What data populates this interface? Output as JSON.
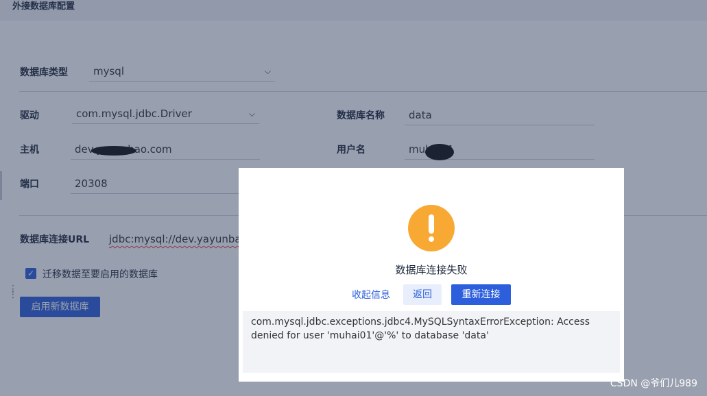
{
  "header": {
    "title": "外接数据库配置"
  },
  "form": {
    "db_type": {
      "label": "数据库类型",
      "value": "mysql"
    },
    "driver": {
      "label": "驱动",
      "value": "com.mysql.jdbc.Driver"
    },
    "db_name": {
      "label": "数据库名称",
      "value": "data"
    },
    "host": {
      "label": "主机",
      "value": "dev.yayunbao.com"
    },
    "username": {
      "label": "用户名",
      "value": "muhai01"
    },
    "port": {
      "label": "端口",
      "value": "20308"
    },
    "url": {
      "label": "数据库连接URL",
      "value": "jdbc:mysql://dev.yayunbao"
    },
    "migrate_checkbox": {
      "label": "迁移数据至要启用的数据库",
      "checked": true
    },
    "enable_button": {
      "label": "启用新数据库"
    }
  },
  "dialog": {
    "icon": "warning-icon",
    "title": "数据库连接失败",
    "collapse_label": "收起信息",
    "back_label": "返回",
    "reconnect_label": "重新连接",
    "error_message": "com.mysql.jdbc.exceptions.jdbc4.MySQLSyntaxErrorException: Access denied for user 'muhai01'@'%' to database 'data'"
  },
  "watermark": "CSDN @爷们儿989",
  "colors": {
    "accent": "#2d5fdd",
    "warning": "#f8a933",
    "overlay": "rgba(40,55,85,0.48)"
  }
}
